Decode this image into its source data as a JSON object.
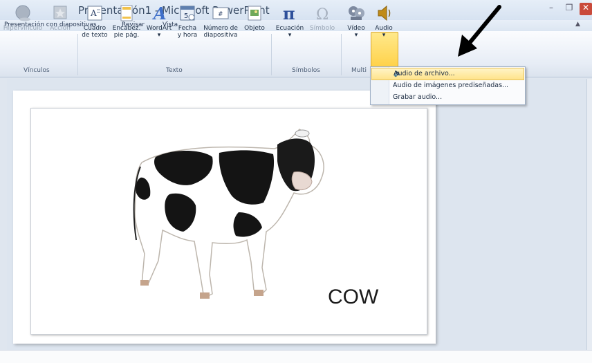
{
  "window": {
    "title": "Presentación1  -  Microsoft PowerPoint"
  },
  "tabs": [
    "Presentación con diapositivas",
    "Revisar",
    "Vista"
  ],
  "ribbon": {
    "buttons": [
      {
        "label1": "Hipervínculo",
        "label2": "",
        "disabled": true
      },
      {
        "label1": "Acción",
        "label2": "",
        "disabled": true
      },
      {
        "label1": "Cuadro",
        "label2": "de texto",
        "disabled": false
      },
      {
        "label1": "Encabez.",
        "label2": "pie pág.",
        "disabled": false
      },
      {
        "label1": "WordArt",
        "label2": "▾",
        "disabled": false
      },
      {
        "label1": "Fecha",
        "label2": "y hora",
        "disabled": false
      },
      {
        "label1": "Número de",
        "label2": "diapositiva",
        "disabled": false
      },
      {
        "label1": "Objeto",
        "label2": "",
        "disabled": false
      },
      {
        "label1": "Ecuación",
        "label2": "▾",
        "disabled": false
      },
      {
        "label1": "Símbolo",
        "label2": "",
        "disabled": true
      },
      {
        "label1": "Vídeo",
        "label2": "▾",
        "disabled": false
      },
      {
        "label1": "Audio",
        "label2": "▾",
        "disabled": false
      }
    ],
    "groups": [
      "Vínculos",
      "Texto",
      "Símbolos",
      "Multi"
    ]
  },
  "audio_menu": {
    "items": [
      "Audio de archivo...",
      "Audio de imágenes prediseñadas...",
      "Grabar audio..."
    ]
  },
  "slide": {
    "caption": "COW"
  },
  "colors": {
    "accent": "#ffd24a",
    "title": "#3a4d66"
  }
}
